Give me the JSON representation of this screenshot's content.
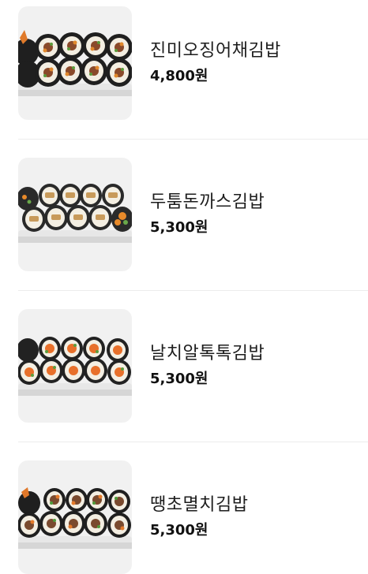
{
  "menu": {
    "items": [
      {
        "name": "진미오징어채김밥",
        "price": "4,800원",
        "image": "kimbap-photo"
      },
      {
        "name": "두툼돈까스김밥",
        "price": "5,300원",
        "image": "kimbap-photo"
      },
      {
        "name": "날치알톡톡김밥",
        "price": "5,300원",
        "image": "kimbap-photo"
      },
      {
        "name": "땡초멸치김밥",
        "price": "5,300원",
        "image": "kimbap-photo"
      }
    ]
  },
  "colors": {
    "thumb_bg": "#f1f1f1",
    "divider": "#ececec",
    "seaweed": "#1f1f1f",
    "rice": "#f4efe3",
    "plate": "#e9e9e9"
  }
}
